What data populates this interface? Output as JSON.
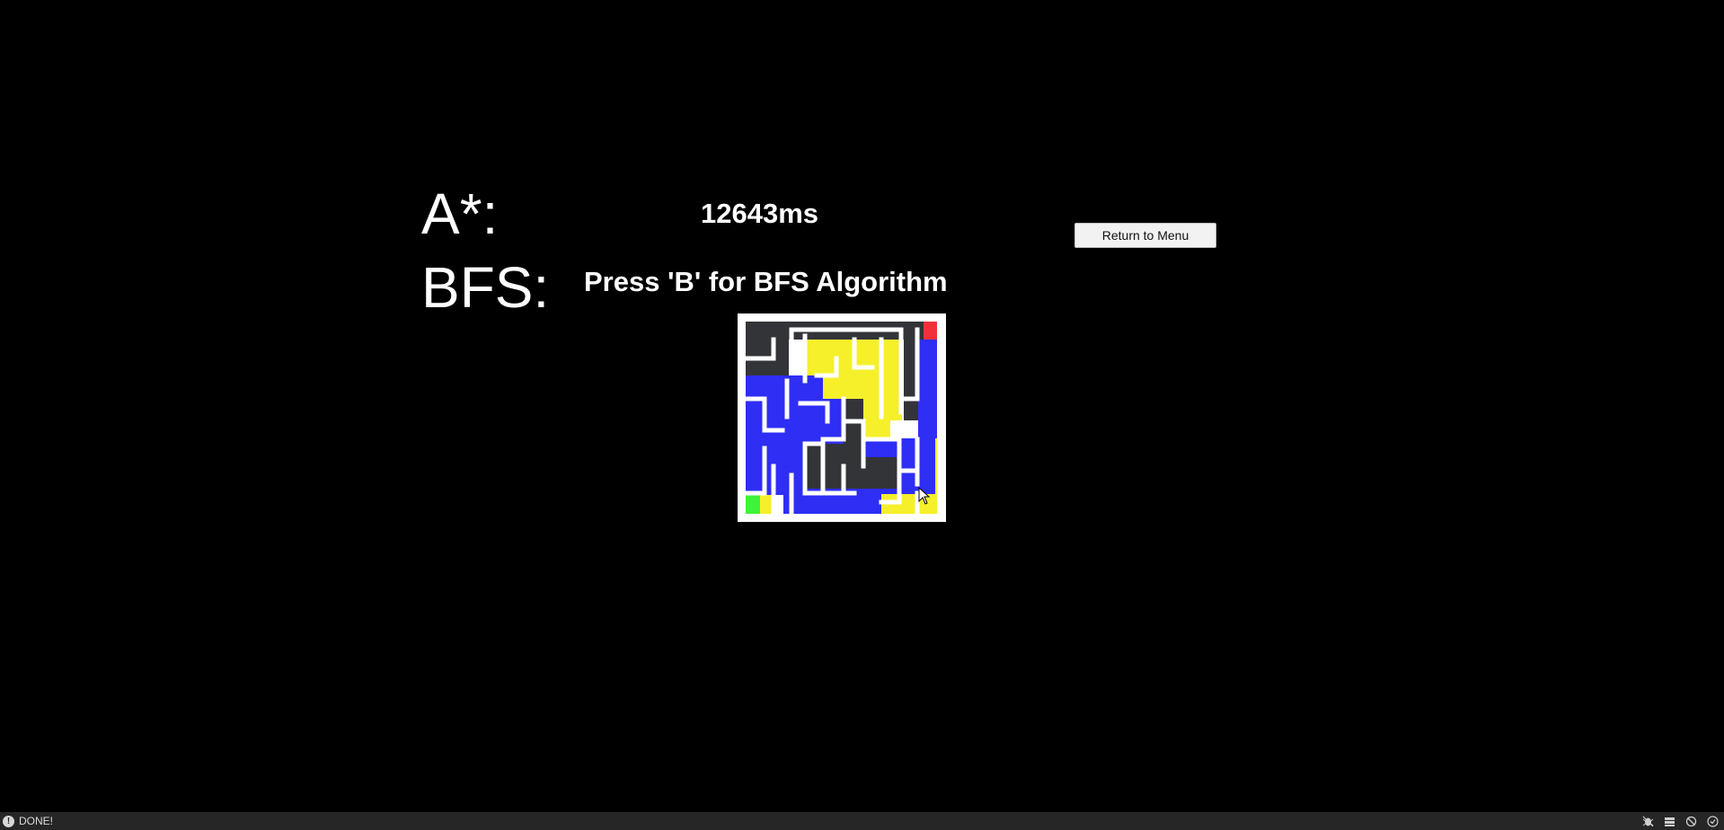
{
  "results": {
    "astar_label": "A*:",
    "astar_time": "12643ms",
    "bfs_label": "BFS:",
    "bfs_prompt": "Press 'B' for BFS Algorithm"
  },
  "return_button_label": "Return to Menu",
  "maze": {
    "size": "12x12",
    "colors": {
      "background": "#000000",
      "wall": "#ffffff",
      "unvisited": "#333438",
      "explored": "#2e2ef5",
      "path": "#f5f02a",
      "start": "#3ff23a",
      "goal": "#f2303a"
    }
  },
  "status_bar": {
    "text": "DONE!",
    "icons": [
      "bug-icon",
      "layers-icon",
      "no-signal-icon",
      "settings-icon"
    ]
  }
}
